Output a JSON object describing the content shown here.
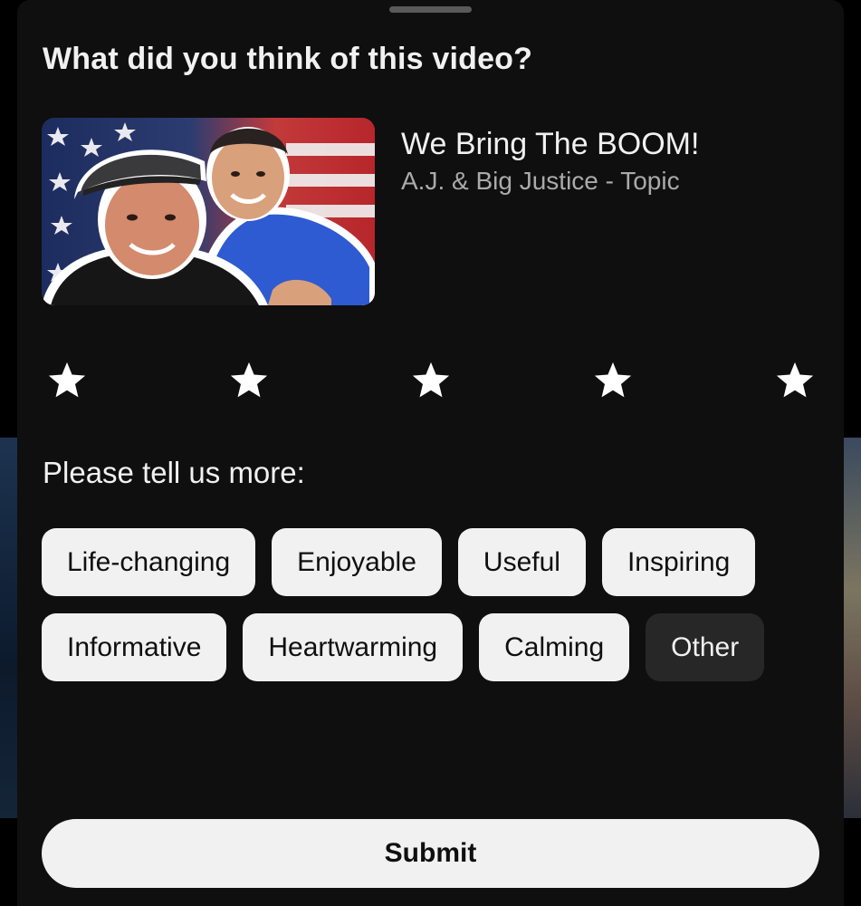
{
  "dialog": {
    "title": "What did you think of this video?"
  },
  "video": {
    "title": "We Bring The BOOM!",
    "channel": "A.J. & Big Justice - Topic"
  },
  "rating": {
    "max_stars": 5,
    "selected": 0,
    "star_color": "#ffffff"
  },
  "feedback": {
    "prompt": "Please tell us more:",
    "options": [
      {
        "label": "Life-changing",
        "selected": false
      },
      {
        "label": "Enjoyable",
        "selected": false
      },
      {
        "label": "Useful",
        "selected": false
      },
      {
        "label": "Inspiring",
        "selected": false
      },
      {
        "label": "Informative",
        "selected": false
      },
      {
        "label": "Heartwarming",
        "selected": false
      },
      {
        "label": "Calming",
        "selected": false
      },
      {
        "label": "Other",
        "selected": false
      }
    ]
  },
  "submit_label": "Submit",
  "colors": {
    "sheet_background": "#0f0f0f",
    "chip_light": "#f1f1f1",
    "chip_dark": "#272727",
    "secondary_text": "#aaaaaa"
  }
}
